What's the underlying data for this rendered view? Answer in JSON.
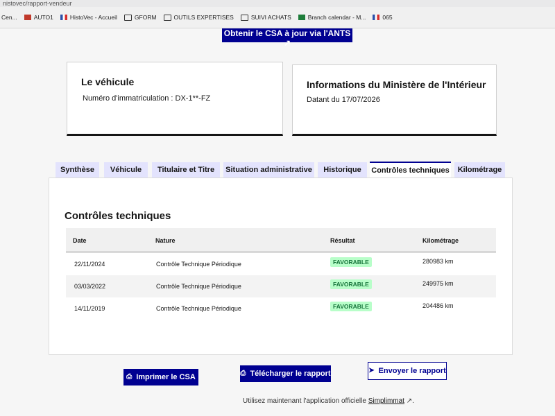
{
  "browser": {
    "url_fragment": "nistovec/rapport-vendeur",
    "bookmarks": [
      {
        "label": "Cen...",
        "icon": "page-icon"
      },
      {
        "label": "AUTO1",
        "icon": "red-square-icon"
      },
      {
        "label": "HistoVec - Accueil",
        "icon": "flag-icon"
      },
      {
        "label": "GFORM",
        "icon": "folder-icon"
      },
      {
        "label": "OUTILS EXPERTISES",
        "icon": "folder-icon"
      },
      {
        "label": "SUIVI ACHATS",
        "icon": "folder-icon"
      },
      {
        "label": "Branch calendar - M...",
        "icon": "green-square-icon"
      },
      {
        "label": "065",
        "icon": "flag-icon"
      }
    ]
  },
  "header": {
    "csa_button": "Obtenir le CSA à jour via l'ANTS"
  },
  "vehicle_card": {
    "title": "Le véhicule",
    "plate_line": "Numéro d'immatriculation : DX-1**-FZ"
  },
  "ministry_card": {
    "title": "Informations du Ministère de l'Intérieur",
    "date_line": "Datant du 17/07/2026"
  },
  "tabs": [
    {
      "label": "Synthèse"
    },
    {
      "label": "Véhicule"
    },
    {
      "label": "Titulaire et Titre"
    },
    {
      "label": "Situation administrative"
    },
    {
      "label": "Historique"
    },
    {
      "label": "Contrôles techniques",
      "active": true
    },
    {
      "label": "Kilométrage"
    }
  ],
  "panel": {
    "title": "Contrôles techniques",
    "columns": [
      "Date",
      "Nature",
      "Résultat",
      "Kilométrage"
    ],
    "rows": [
      {
        "date": "22/11/2024",
        "nature": "Contrôle Technique Périodique",
        "result": "FAVORABLE",
        "km": "280983 km"
      },
      {
        "date": "03/03/2022",
        "nature": "Contrôle Technique Périodique",
        "result": "FAVORABLE",
        "km": "249975 km"
      },
      {
        "date": "14/11/2019",
        "nature": "Contrôle Technique Périodique",
        "result": "FAVORABLE",
        "km": "204486 km"
      }
    ]
  },
  "actions": {
    "print": "Imprimer le CSA",
    "download": "Télécharger le rapport",
    "send": "Envoyer le rapport"
  },
  "footer": {
    "text": "Utilisez maintenant l'application officielle",
    "link": "Simplimmat"
  },
  "colors": {
    "primary": "#000091",
    "tab_bg": "#e3e3fd",
    "badge_bg": "#b8fec9",
    "badge_text": "#18753c"
  }
}
